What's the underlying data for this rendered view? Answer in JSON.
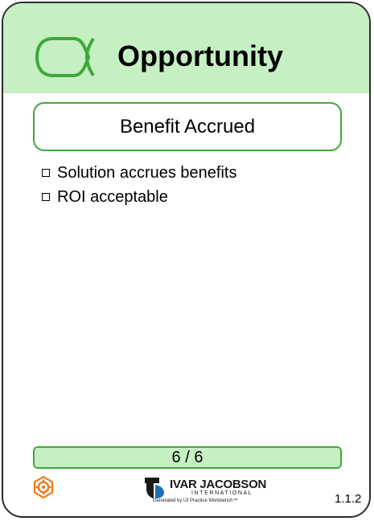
{
  "card": {
    "title": "Opportunity",
    "state": "Benefit Accrued",
    "checklist": [
      {
        "label": "Solution accrues benefits",
        "checked": false
      },
      {
        "label": "ROI acceptable",
        "checked": false
      }
    ],
    "progress": {
      "label": "6 / 6",
      "value": 6,
      "total": 6
    },
    "version": "1.1.2"
  },
  "footer": {
    "logo_name": "IVAR JACOBSON",
    "logo_sub": "INTERNATIONAL",
    "generated_by": "Generated by IJI Practice Workbench™"
  },
  "colors": {
    "header_bg": "#c6efc3",
    "accent_green": "#3fa83a",
    "gear_orange": "#f07c1e",
    "logo_blue": "#1d6fb8"
  },
  "icons": {
    "alpha": "alpha-icon",
    "gear": "gear-icon",
    "logo": "ivar-jacobson-logo-icon"
  }
}
